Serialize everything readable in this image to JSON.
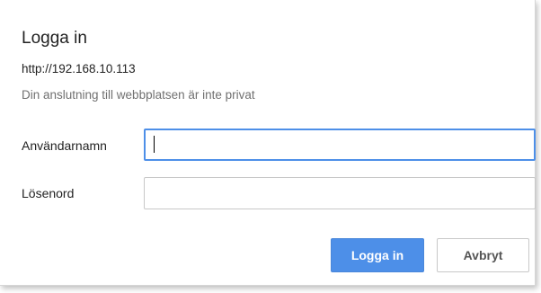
{
  "dialog": {
    "title": "Logga in",
    "url": "http://192.168.10.113",
    "notice": "Din anslutning till webbplatsen är inte privat"
  },
  "form": {
    "username_label": "Användarnamn",
    "username_value": "",
    "password_label": "Lösenord",
    "password_value": ""
  },
  "buttons": {
    "login_label": "Logga in",
    "cancel_label": "Avbryt"
  },
  "colors": {
    "accent": "#4d8fe8",
    "muted_text": "#707070",
    "border": "#c8c8c8"
  }
}
